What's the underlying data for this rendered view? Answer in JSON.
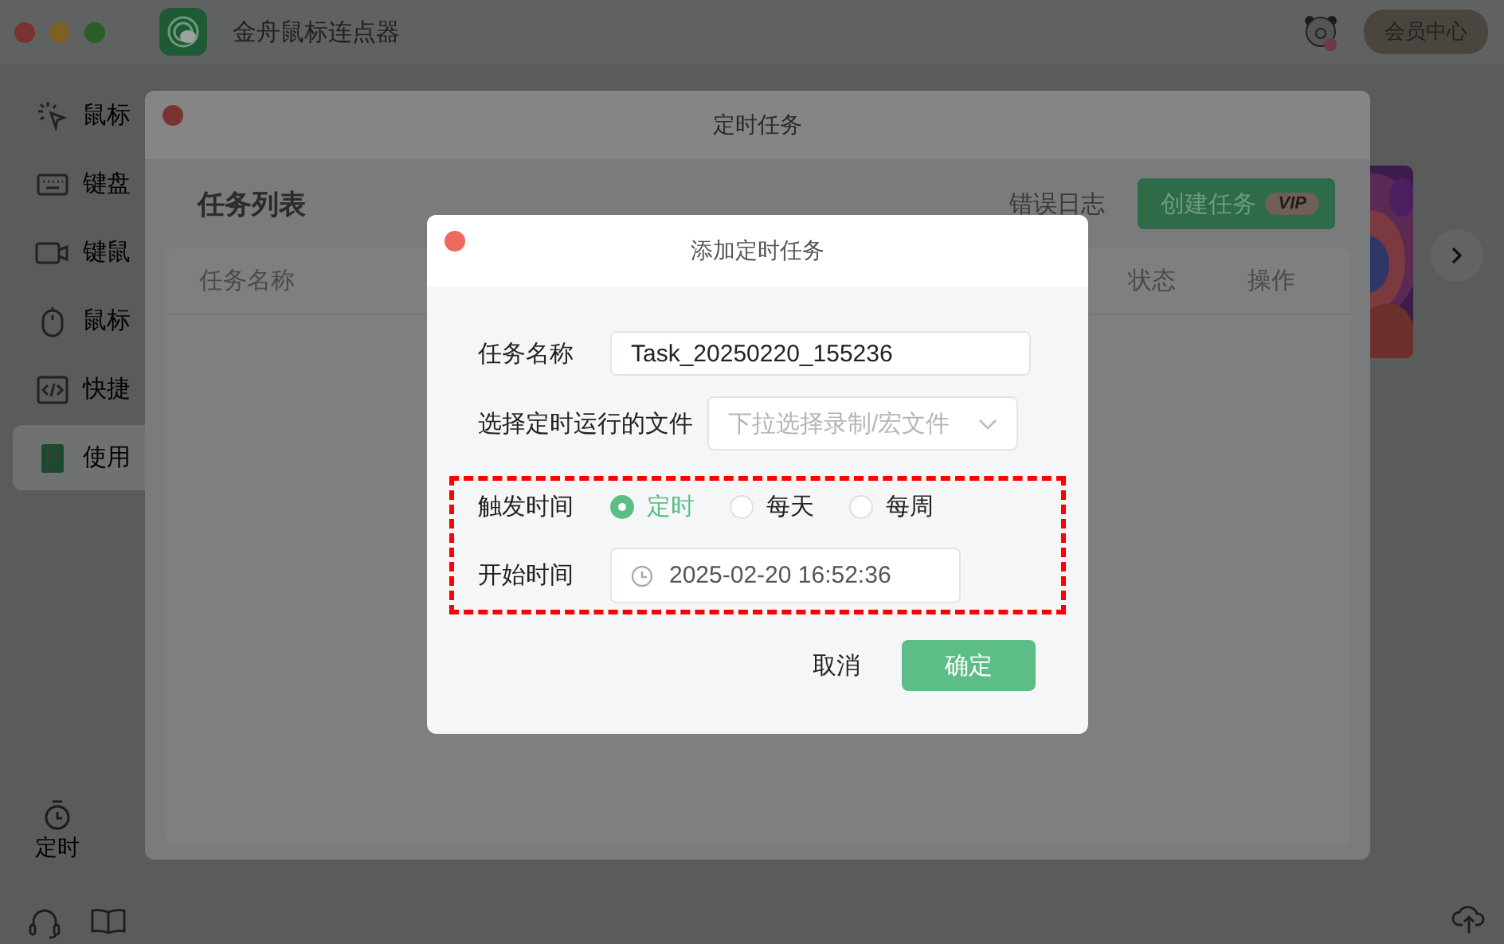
{
  "app": {
    "title": "金舟鼠标连点器",
    "member_button": "会员中心"
  },
  "sidebar": {
    "items": [
      {
        "kind": "click",
        "label": "鼠标",
        "selected": false
      },
      {
        "kind": "keyboard",
        "label": "键盘",
        "selected": false
      },
      {
        "kind": "record",
        "label": "键鼠",
        "selected": false
      },
      {
        "kind": "mouse",
        "label": "鼠标",
        "selected": false
      },
      {
        "kind": "code",
        "label": "快捷",
        "selected": false
      },
      {
        "kind": "book",
        "label": "使用",
        "selected": true
      }
    ],
    "bottom_item": "定时"
  },
  "task_window": {
    "title": "定时任务",
    "heading": "任务列表",
    "error_log_link": "错误日志",
    "create_button": {
      "label": "创建任务",
      "badge": "VIP"
    },
    "table": {
      "columns": [
        "任务名称",
        "状态",
        "操作"
      ]
    }
  },
  "dialog": {
    "title": "添加定时任务",
    "fields": [
      {
        "kind": "text",
        "label": "任务名称",
        "value": "Task_20250220_155236"
      },
      {
        "kind": "select",
        "label": "选择定时运行的文件",
        "placeholder": "下拉选择录制/宏文件"
      }
    ],
    "trigger": {
      "label": "触发时间",
      "options": [
        {
          "label": "定时",
          "selected": true
        },
        {
          "label": "每天",
          "selected": false
        },
        {
          "label": "每周",
          "selected": false
        }
      ]
    },
    "start_time": {
      "label": "开始时间",
      "value": "2025-02-20 16:52:36"
    },
    "buttons": [
      {
        "kind": "secondary",
        "label": "取消"
      },
      {
        "kind": "primary",
        "label": "确定"
      }
    ]
  }
}
